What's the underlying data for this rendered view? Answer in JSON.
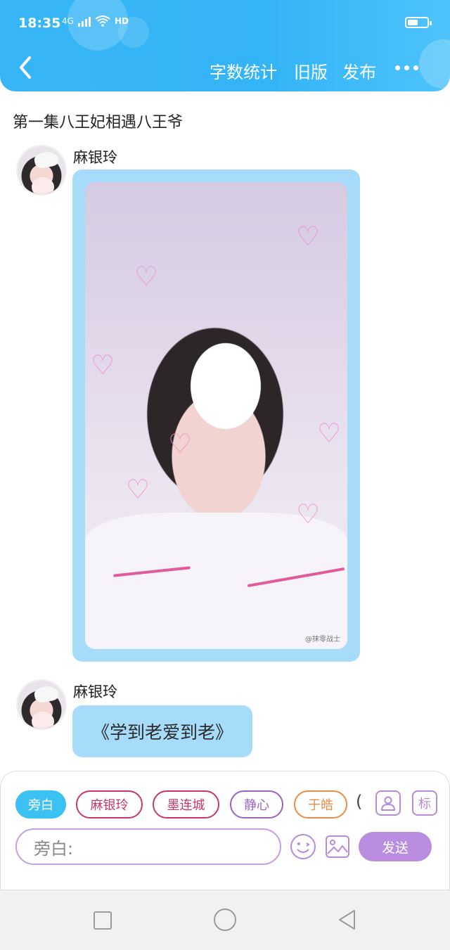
{
  "status_bar": {
    "time": "18:35",
    "network": "4G",
    "hd": "HD"
  },
  "header": {
    "actions": {
      "word_count": "字数统计",
      "old_version": "旧版",
      "publish": "发布"
    }
  },
  "chapter": {
    "title": "第一集八王妃相遇八王爷"
  },
  "messages": [
    {
      "sender": "麻银玲",
      "type": "image"
    },
    {
      "sender": "麻银玲",
      "type": "text",
      "text": "《学到老爱到老》"
    }
  ],
  "photo": {
    "watermark": "@抹零战士"
  },
  "roles": [
    {
      "label": "旁白",
      "color": "#3cc1f3"
    },
    {
      "label": "麻银玲",
      "color": "#c73868"
    },
    {
      "label": "墨连城",
      "color": "#c73868"
    },
    {
      "label": "静心",
      "color": "#9b64c4"
    },
    {
      "label": "于皓",
      "color": "#ea8d47"
    },
    {
      "label": "(",
      "color": "#444444"
    }
  ],
  "tools": {
    "mark_label": "标"
  },
  "composer": {
    "placeholder": "旁白:",
    "send_label": "发送"
  },
  "colors": {
    "header": "#37b6f5",
    "bubble": "#a6dcfa",
    "accent_purple": "#b98ee0"
  }
}
